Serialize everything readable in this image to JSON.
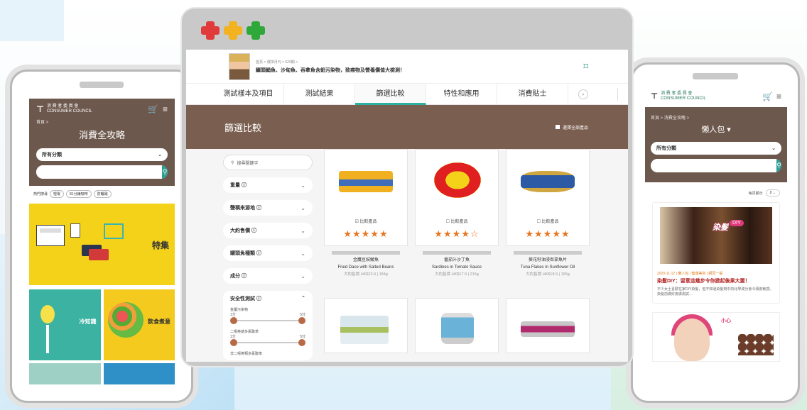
{
  "browser": {
    "header": {
      "breadcrumb": "首頁 > 選擇月刊 > 529期 >",
      "title": "鱷頭鯧魚、沙甸魚、吞拿魚含鉛污染物，致癌物及營養價值大檢測！"
    },
    "tabs": [
      {
        "label": "測試樣本及項目"
      },
      {
        "label": "測試結果"
      },
      {
        "label": "篩選比較"
      },
      {
        "label": "特性和應用"
      },
      {
        "label": "消費貼士"
      }
    ],
    "filter_title": "篩選比較",
    "show_all_label": "選擇全部產品",
    "search_placeholder": "搜尋關鍵字",
    "facets": [
      {
        "label": "重量 ⓘ"
      },
      {
        "label": "聲稱來源地 ⓘ"
      },
      {
        "label": "大約售價 ⓘ"
      },
      {
        "label": "罐頭魚種類 ⓘ"
      },
      {
        "label": "成分 ⓘ"
      }
    ],
    "safety": {
      "label": "安全性測試 ⓘ",
      "ranges": [
        {
          "label": "金屬污染物",
          "min": "1分",
          "max": "5分"
        },
        {
          "label": "二噁英總多氯聯苯",
          "min": "1分",
          "max": "5分"
        },
        {
          "label": "非二噁英類多氯聯苯"
        }
      ]
    },
    "products": [
      {
        "compare": "比較產品",
        "stars": "★★★★★",
        "checked": true,
        "zh": "金鷹豆豉鯪魚",
        "en": "Fried Dace with Salted Beans",
        "price": "大約售價 HK$23.9 | 184g"
      },
      {
        "compare": "比較產品",
        "stars": "★★★★☆",
        "checked": false,
        "zh": "番茄汁沙丁魚",
        "en": "Sardines in Tomato Sauce",
        "price": "大約售價 HK$17.9 | 215g"
      },
      {
        "compare": "比較產品",
        "stars": "★★★★★",
        "checked": false,
        "zh": "葵花籽油浸吞拿魚片",
        "en": "Tuna Flakes in Sunflower Oil",
        "price": "大約售價 HK$18.9 | 165g"
      }
    ]
  },
  "phone_left": {
    "logo_zh": "消 費 者 委 員 會",
    "logo_en": "CONSUMER COUNCIL",
    "crumb": "首頁 >",
    "title": "消費全攻略",
    "select": "所有分類",
    "hot_label": "熱門搜尋",
    "hot_tags": [
      "慳電",
      "81分鐘咖啡",
      "防曬霜"
    ],
    "feature_label": "特集",
    "tile1": "冷知識",
    "tile2": "飲食煮意"
  },
  "phone_right": {
    "logo_zh": "消 費 者 委 員 會",
    "logo_en": "CONSUMER COUNCIL",
    "crumb": "首頁 > 消費全攻略 >",
    "title": "懶人包 ▾",
    "select": "所有分類",
    "sort_label": "每頁顯示",
    "sort_value": "8 ⌄",
    "article": {
      "meta": "2020-11-12 | 懶人包 | 健康美容 | 網頁一般",
      "title": "染髮DIY：留意這幾步令你掀起後果大噩！",
      "desc": "不少女士喜歡在家DIY染髮，但不知道染髮劑中的化學成分會令頭皮敏感。染髮前做好皮膚測試…",
      "overlay": "染髮",
      "badge": "DIY"
    },
    "article2_text": "小心"
  }
}
